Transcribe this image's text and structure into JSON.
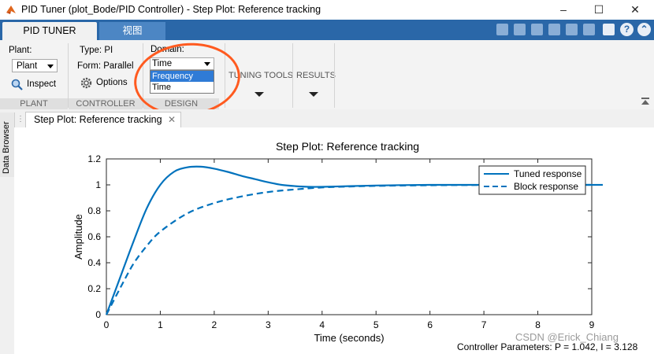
{
  "window": {
    "title": "PID Tuner (plot_Bode/PID Controller) - Step Plot: Reference tracking",
    "minimize": "–",
    "maximize": "☐",
    "close": "✕"
  },
  "tabs": [
    {
      "label": "PID TUNER",
      "active": true
    },
    {
      "label": "视图",
      "active": false
    }
  ],
  "ribbon": {
    "plant": {
      "title": "Plant:",
      "selected": "Plant",
      "inspect_label": "Inspect",
      "group_label": "PLANT"
    },
    "controller": {
      "type_text": "Type: PI",
      "form_text": "Form: Parallel",
      "options_label": "Options",
      "group_label": "CONTROLLER"
    },
    "design": {
      "domain_title": "Domain:",
      "domain_selected": "Time",
      "domain_options": [
        "Frequency",
        "Time"
      ],
      "group_label": "DESIGN"
    },
    "tuning_tools_label": "TUNING TOOLS",
    "results_label": "RESULTS"
  },
  "side_panel": {
    "label": "Data Browser"
  },
  "document_tab": {
    "label": "Step Plot: Reference tracking",
    "close": "✕"
  },
  "colors": {
    "accent": "#2a67a8",
    "line": "#0072bd",
    "highlight_ring": "#ff5a1f"
  },
  "chart_data": {
    "type": "line",
    "title": "Step Plot: Reference tracking",
    "xlabel": "Time (seconds)",
    "ylabel": "Amplitude",
    "xlim": [
      0,
      9
    ],
    "ylim": [
      0,
      1.2
    ],
    "x_ticks": [
      "0",
      "1",
      "2",
      "3",
      "4",
      "5",
      "6",
      "7",
      "8",
      "9"
    ],
    "y_ticks": [
      "0",
      "0.2",
      "0.4",
      "0.6",
      "0.8",
      "1",
      "1.2"
    ],
    "grid": false,
    "legend_position": "top-right",
    "series": [
      {
        "name": "Tuned response",
        "style": "solid",
        "x": [
          0,
          0.25,
          0.5,
          0.75,
          1.0,
          1.25,
          1.5,
          1.75,
          2.0,
          2.25,
          2.5,
          2.75,
          3.0,
          3.25,
          3.5,
          3.75,
          4.0,
          4.5,
          5.0,
          5.5,
          6.0,
          7.0,
          8.0,
          9.0
        ],
        "y": [
          0,
          0.28,
          0.56,
          0.82,
          1.0,
          1.1,
          1.135,
          1.14,
          1.125,
          1.1,
          1.07,
          1.045,
          1.02,
          1.0,
          0.99,
          0.985,
          0.985,
          0.99,
          0.995,
          0.998,
          1.0,
          1.0,
          1.0,
          1.0
        ]
      },
      {
        "name": "Block response",
        "style": "dashed",
        "x": [
          0,
          0.25,
          0.5,
          0.75,
          1.0,
          1.5,
          2.0,
          2.5,
          3.0,
          3.5,
          4.0,
          4.5,
          5.0,
          6.0,
          7.0,
          8.0,
          9.0
        ],
        "y": [
          0,
          0.2,
          0.39,
          0.53,
          0.64,
          0.78,
          0.86,
          0.91,
          0.945,
          0.965,
          0.98,
          0.987,
          0.992,
          0.997,
          0.999,
          1.0,
          1.0
        ]
      }
    ]
  },
  "watermark": "CSDN @Erick_Chiang",
  "footer": "Controller Parameters: P = 1.042, I = 3.128"
}
